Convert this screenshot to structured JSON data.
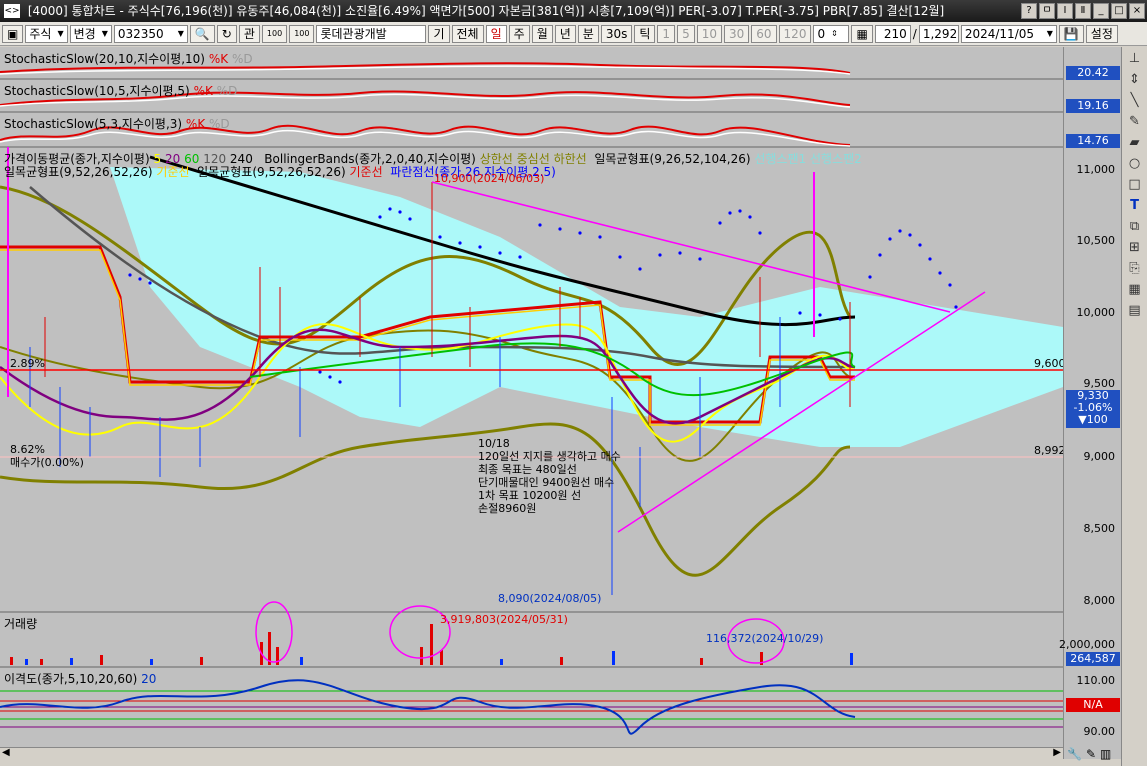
{
  "window": {
    "title": "[4000] 통합차트 - 주식수[76,196(천)] 유동주[46,084(천)] 소진율[6.49%] 액면가[500] 자본금[381(억)] 시총[7,109(억)] PER[-3.07] T.PER[-3.75] PBR[7.85] 결산[12월]",
    "sys_icon": "<>",
    "controls": [
      "?",
      "ㅁ",
      "Ⅰ",
      "Ⅱ",
      "_",
      "□",
      "×"
    ]
  },
  "toolbar": {
    "market": "주식",
    "mode": "변경",
    "code": "032350",
    "name": "롯데관광개발",
    "period_btns": [
      "기",
      "전체",
      "일",
      "주",
      "월",
      "년",
      "분",
      "30s",
      "틱"
    ],
    "period_active": "일",
    "interval_btns": [
      "1",
      "5",
      "10",
      "30",
      "60",
      "120"
    ],
    "interval_value": "0",
    "count": "210",
    "total": "1,292",
    "date": "2024/11/05",
    "settings": "설정",
    "misc_icons": [
      "search-icon",
      "refresh-icon",
      "link-icon",
      "100-icon",
      "100-icon"
    ],
    "label_gwan": "관"
  },
  "panels": {
    "stoch1": "StochasticSlow(20,10,지수이평,10)",
    "stoch1_k": "%K",
    "stoch1_d": "%D",
    "stoch1_val": "20.42",
    "stoch2": "StochasticSlow(10,5,지수이평,5)",
    "stoch2_k": "%K",
    "stoch2_d": "%D",
    "stoch2_val": "19.16",
    "stoch3": "StochasticSlow(5,3,지수이평,3)",
    "stoch3_k": "%K",
    "stoch3_d": "%D",
    "stoch3_val": "14.76",
    "main_legend1": "가격이동평균(종가,지수이평)",
    "ma_periods": [
      "5",
      "20",
      "60",
      "120",
      "240"
    ],
    "bollinger": "BollingerBands(종가,2,0,40,지수이평)",
    "boll_upper": "상한선",
    "boll_mid": "중심선",
    "boll_lower": "하한선",
    "ichimoku1": "일목균형표(9,26,52,104,26)",
    "span1": "선행스팬1",
    "span2": "선행스팬2",
    "ichimoku2": "일목균형표(9,52,26,52,26)",
    "kijun2": "기준선",
    "ichimoku3": "일목균형표(9,52,26,52,26)",
    "kijun3": "기준선",
    "parabolic": "파란점선(종가,26,지수이평,2.5)",
    "volume_label": "거래량",
    "disparity": "이격도(종가,5,10,20,60)",
    "disparity_period": "20"
  },
  "annotations": {
    "high": "10,900(2024/06/03)",
    "low": "8,090(2024/08/05)",
    "vol_peak": "3,919,803(2024/05/31)",
    "vol_other": "116,372(2024/10/29)",
    "left_pct1": "2.89%",
    "left_pct2": "8.62%",
    "left_note": "매수가(0.00%)",
    "note_date": "10/18",
    "note_lines": [
      "120일선 지지를 생각하고 매수",
      "최종 목표는 480일선",
      "단기매물대인 9400원선 매수",
      "1차 목표 10200원 선",
      "손절8960원"
    ]
  },
  "scale": {
    "price_ticks": [
      "11,000",
      "10,500",
      "10,000",
      "9,500",
      "9,000",
      "8,500",
      "8,000"
    ],
    "level_9600": "9,600",
    "level_8992": "8,992",
    "current_price": "9,330",
    "change_pct": "-1.06%",
    "change_amt": "▼100",
    "vol_tick": "2,000,000",
    "vol_current": "264,587",
    "disp_ticks": [
      "110.00",
      "90.00"
    ],
    "disp_current": "N/A"
  },
  "colors": {
    "kumo": "#aaffff",
    "red_line": "#ff0000",
    "magenta": "#ff00ff",
    "olive": "#808000",
    "blue_dot": "#0000ff",
    "badge_blue": "#2050c0",
    "badge_red": "#e00000"
  },
  "chart_data": {
    "type": "candlestick",
    "date_range": [
      "",
      "2024/11/05"
    ],
    "price_range": [
      8000,
      11200
    ],
    "last_price": 9330,
    "high": {
      "value": 10900,
      "date": "2024/06/03"
    },
    "low": {
      "value": 8090,
      "date": "2024/08/05"
    },
    "horizontal_lines": [
      9600,
      8992
    ],
    "volume_peak": {
      "value": 3919803,
      "date": "2024/05/31"
    },
    "volume_last": 264587
  }
}
